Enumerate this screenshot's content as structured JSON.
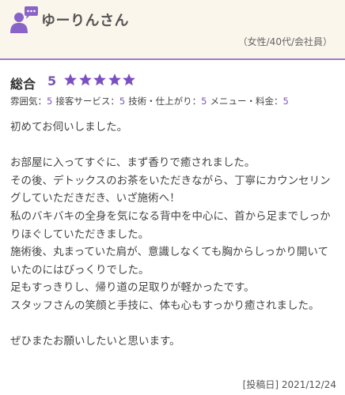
{
  "reviewer": {
    "name": "ゆーりんさん",
    "meta": "（女性/40代/会社員）",
    "avatar_icon": "user-comment-icon",
    "accent_color": "#8a63c9"
  },
  "rating": {
    "overall_label": "総合",
    "overall_score": "5",
    "stars": 5,
    "star_color": "#7b4fc2",
    "sub_ratings": [
      {
        "label": "雰囲気：",
        "score": "5"
      },
      {
        "label": "接客サービス：",
        "score": "5"
      },
      {
        "label": "技術・仕上がり：",
        "score": "5"
      },
      {
        "label": "メニュー・料金：",
        "score": "5"
      }
    ]
  },
  "review": {
    "paragraphs": [
      "初めてお伺いしました。",
      "",
      "お部屋に入ってすぐに、まず香りで癒されました。",
      "その後、デトックスのお茶をいただきながら、丁寧にカウンセリングしていただきだき、いざ施術へ！",
      "私のバキバキの全身を気になる背中を中心に、首から足までしっかりほぐしていただきました。",
      "施術後、丸まっていた肩が、意識しなくても胸からしっかり開いていたのにはびっくりでした。",
      "足もすっきりし、帰り道の足取りが軽かったです。",
      "スタッフさんの笑顔と手技に、体も心もすっかり癒されました。",
      "",
      "ぜひまたお願いしたいと思います。"
    ]
  },
  "post_date": "[投稿日] 2021/12/24"
}
